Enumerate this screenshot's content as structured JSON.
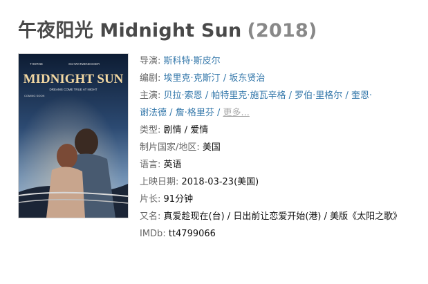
{
  "title": {
    "zh": "午夜阳光 Midnight Sun",
    "year": "(2018)"
  },
  "poster": {
    "actors_left": "THORNE",
    "actors_right": "SCHWARZENEGGER",
    "movie_title": "MIDNIGHT SUN",
    "tagline": "DREAMS COME TRUE AT NIGHT",
    "coming_soon": "COMING SOON"
  },
  "info": {
    "director": {
      "label": "导演:",
      "names": [
        "斯科特·斯皮尔"
      ]
    },
    "writer": {
      "label": "编剧:",
      "names": [
        "埃里克·克斯汀",
        "坂东贤治"
      ]
    },
    "cast": {
      "label": "主演:",
      "names": [
        "贝拉·索恩",
        "帕特里克·施瓦辛格",
        "罗伯·里格尔",
        "奎恩·",
        "谢法德",
        "詹·格里芬"
      ],
      "more": "更多..."
    },
    "genre": {
      "label": "类型:",
      "values": [
        "剧情",
        "爱情"
      ]
    },
    "country": {
      "label": "制片国家/地区:",
      "value": "美国"
    },
    "language": {
      "label": "语言:",
      "value": "英语"
    },
    "release": {
      "label": "上映日期:",
      "value": "2018-03-23(美国)"
    },
    "runtime": {
      "label": "片长:",
      "value": "91分钟"
    },
    "aka": {
      "label": "又名:",
      "value": "真爱趁现在(台) / 日出前让恋爱开始(港) / 美版《太阳之歌》"
    },
    "imdb": {
      "label": "IMDb:",
      "value": "tt4799066"
    }
  },
  "colors": {
    "link": "#3377aa",
    "label": "#666666",
    "title": "#494949",
    "year": "#888888"
  }
}
